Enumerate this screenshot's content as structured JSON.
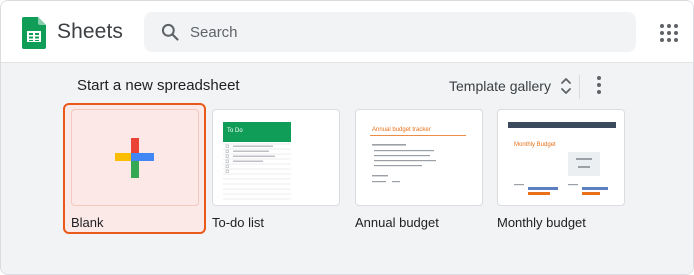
{
  "app": {
    "title": "Sheets"
  },
  "search": {
    "placeholder": "Search"
  },
  "templates": {
    "heading": "Start a new spreadsheet",
    "gallery_label": "Template gallery",
    "cards": [
      {
        "label": "Blank"
      },
      {
        "label": "To-do list",
        "preview_title": "To Do"
      },
      {
        "label": "Annual budget",
        "preview_title": "Annual budget tracker"
      },
      {
        "label": "Monthly budget",
        "preview_title": "Monthly Budget"
      }
    ]
  },
  "colors": {
    "sheets_green": "#0f9d58",
    "selection_orange": "#e8591a",
    "plus_red": "#ea4335",
    "plus_blue": "#4285f4",
    "plus_yellow": "#fbbc04",
    "plus_green": "#34a853"
  },
  "icons": {
    "logo": "sheets-logo-icon",
    "search": "search-icon",
    "apps": "apps-grid-icon",
    "unfold": "unfold-more-icon",
    "more": "more-vert-icon",
    "plus": "plus-icon"
  }
}
